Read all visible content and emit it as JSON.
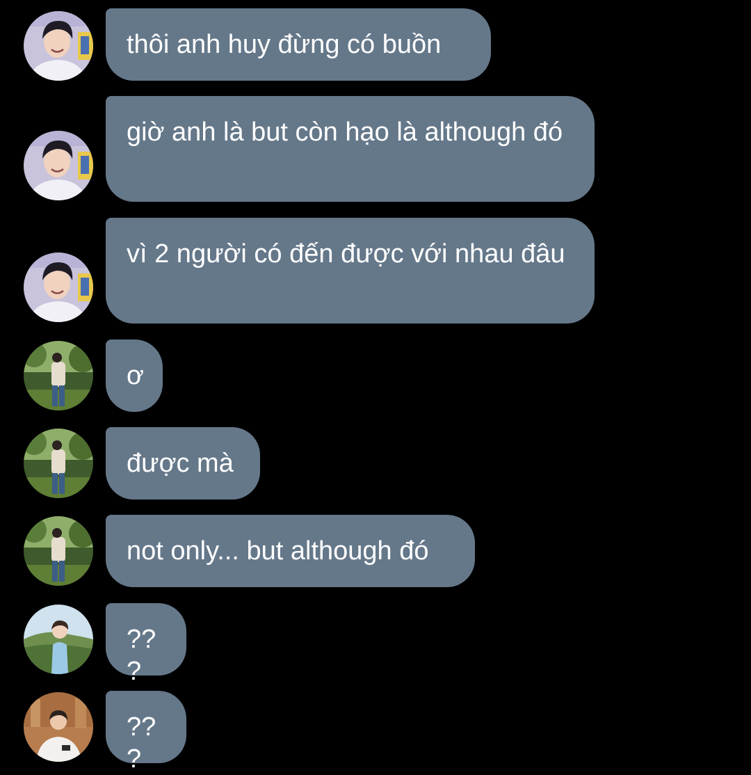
{
  "messages": [
    {
      "sender": "user-a",
      "text": "thôi anh huy đừng có buồn"
    },
    {
      "sender": "user-a",
      "text": "giờ anh là but còn hạo là although đó"
    },
    {
      "sender": "user-a",
      "text": "vì 2 người có đến được với nhau đâu"
    },
    {
      "sender": "user-b",
      "text": "ơ"
    },
    {
      "sender": "user-b",
      "text": "được mà"
    },
    {
      "sender": "user-b",
      "text": "not only... but although đó"
    },
    {
      "sender": "user-c",
      "text": "???"
    },
    {
      "sender": "user-d",
      "text": "???"
    }
  ],
  "colors": {
    "background": "#000000",
    "bubble": "#65788a",
    "text": "#ffffff"
  }
}
